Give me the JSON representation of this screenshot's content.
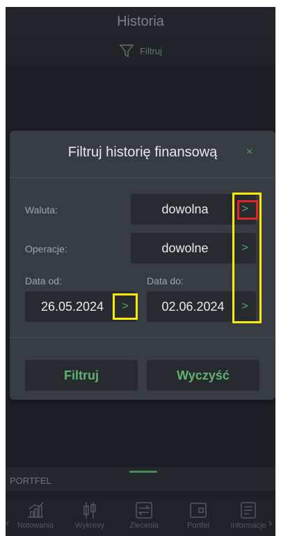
{
  "header": {
    "title": "Historia"
  },
  "filterbar": {
    "label": "Filtruj",
    "icon": "funnel-icon"
  },
  "dialog": {
    "title": "Filtruj historię finansową",
    "close": "×",
    "waluta_label": "Waluta:",
    "waluta_value": "dowolna",
    "operacje_label": "Operacje:",
    "operacje_value": "dowolne",
    "data_od_label": "Data od:",
    "data_od_value": "26.05.2024",
    "data_do_label": "Data do:",
    "data_do_value": "02.06.2024",
    "chevron": ">",
    "filter_button": "Filtruj",
    "clear_button": "Wyczyść"
  },
  "portfel": {
    "label": "PORTFEL"
  },
  "nav": {
    "items": [
      {
        "label": "Notowania",
        "icon": "chart-icon"
      },
      {
        "label": "Wykresy",
        "icon": "candlestick-icon"
      },
      {
        "label": "Zlecenia",
        "icon": "exchange-icon"
      },
      {
        "label": "Portfel",
        "icon": "wallet-icon"
      },
      {
        "label": "Informacje",
        "icon": "info-doc-icon"
      }
    ]
  },
  "colors": {
    "accent": "#5fb36f",
    "highlight_yellow": "#ffeb00",
    "highlight_red": "#e1262b",
    "background": "#1c1f24",
    "dialog": "#373b42"
  }
}
